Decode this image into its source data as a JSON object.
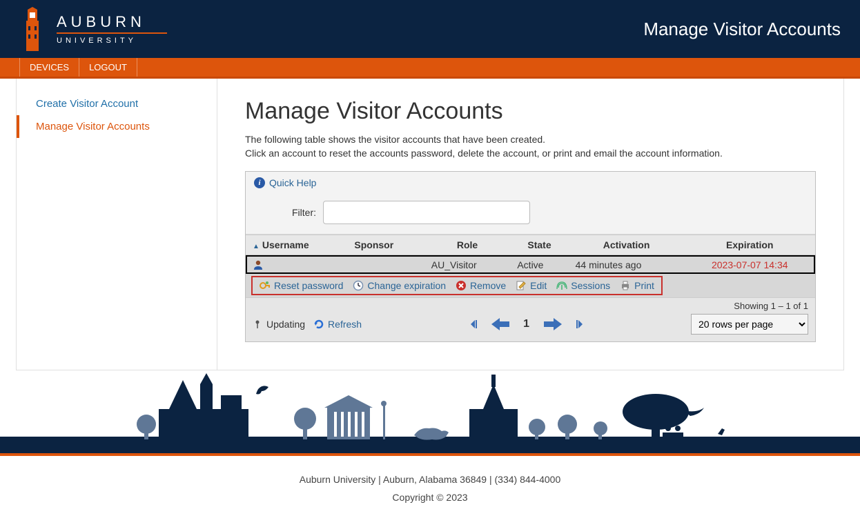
{
  "brand": {
    "name": "AUBURN",
    "sub": "UNIVERSITY"
  },
  "headerTitle": "Manage Visitor Accounts",
  "nav": {
    "devices": "DEVICES",
    "logout": "LOGOUT"
  },
  "sidebar": {
    "create": "Create Visitor Account",
    "manage": "Manage Visitor Accounts"
  },
  "page": {
    "h1": "Manage Visitor Accounts",
    "desc1": "The following table shows the visitor accounts that have been created.",
    "desc2": "Click an account to reset the accounts password, delete the account, or print and email the account information."
  },
  "quickHelp": "Quick Help",
  "filterLabel": "Filter:",
  "columns": {
    "username": "Username",
    "sponsor": "Sponsor",
    "role": "Role",
    "state": "State",
    "activation": "Activation",
    "expiration": "Expiration"
  },
  "row": {
    "username": "",
    "sponsor": "",
    "role": "AU_Visitor",
    "state": "Active",
    "activation": "44 minutes ago",
    "expiration": "2023-07-07 14:34"
  },
  "actions": {
    "reset": "Reset password",
    "change": "Change expiration",
    "remove": "Remove",
    "edit": "Edit",
    "sessions": "Sessions",
    "print": "Print"
  },
  "footerBar": {
    "showing": "Showing 1 – 1 of 1",
    "updating": "Updating",
    "refresh": "Refresh",
    "page": "1",
    "rowsPer": "20 rows per page"
  },
  "footer": {
    "line1": "Auburn University | Auburn, Alabama 36849 | (334) 844-4000",
    "line2": "Copyright © 2023"
  }
}
